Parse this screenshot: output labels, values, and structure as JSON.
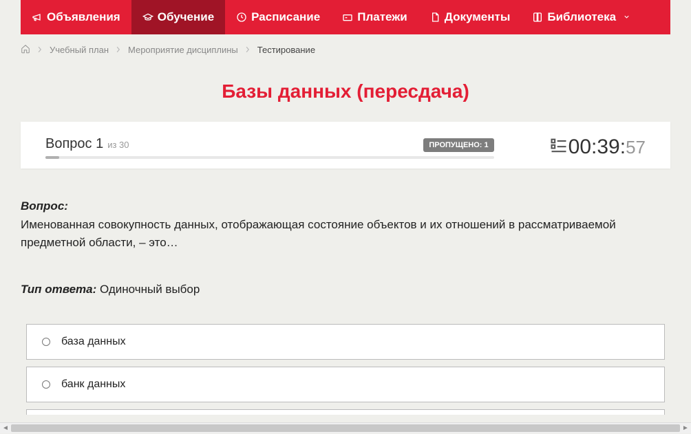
{
  "nav": {
    "items": [
      {
        "label": "Объявления"
      },
      {
        "label": "Обучение"
      },
      {
        "label": "Расписание"
      },
      {
        "label": "Платежи"
      },
      {
        "label": "Документы"
      },
      {
        "label": "Библиотека"
      }
    ]
  },
  "breadcrumbs": {
    "items": [
      {
        "label": "Учебный план"
      },
      {
        "label": "Мероприятие дисциплины"
      },
      {
        "label": "Тестирование"
      }
    ]
  },
  "page_title": "Базы данных (пересдача)",
  "status": {
    "question_label": "Вопрос 1",
    "total_label": "из 30",
    "skipped_label": "ПРОПУЩЕНО: 1",
    "timer_main": "00:39:",
    "timer_sec": "57"
  },
  "question": {
    "label": "Вопрос:",
    "text": "Именованная совокупность данных, отображающая состояние объектов и их отношений в рассматриваемой предметной области, – это…"
  },
  "answer_type": {
    "label": "Тип ответа:",
    "value": "Одиночный выбор"
  },
  "options": [
    {
      "text": "база данных"
    },
    {
      "text": "банк данных"
    }
  ]
}
